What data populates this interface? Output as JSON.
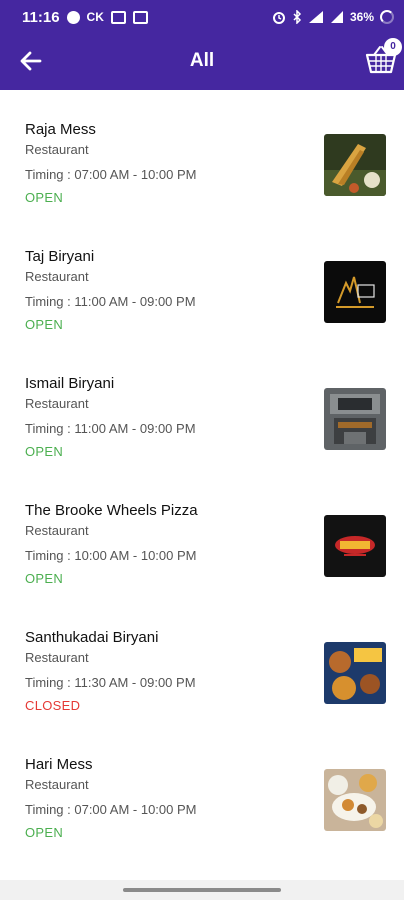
{
  "status_bar": {
    "time": "11:16",
    "network_label": "CK",
    "battery": "36%",
    "icons": [
      "message-icon",
      "ck-icon",
      "media-icon",
      "media-icon",
      "alarm-icon",
      "bluetooth-icon",
      "signal-icon",
      "signal-icon",
      "battery-icon"
    ]
  },
  "app_bar": {
    "title": "All",
    "cart_count": "0",
    "icons": {
      "back": "arrow-left-icon",
      "cart": "basket-icon"
    }
  },
  "colors": {
    "primary": "#4527a0",
    "open": "#4caf50",
    "closed": "#e53935"
  },
  "restaurants": [
    {
      "name": "Raja Mess",
      "category": "Restaurant",
      "timing": "Timing : 07:00 AM - 10:00 PM",
      "status": "OPEN",
      "image": "dosa-image"
    },
    {
      "name": "Taj Biryani",
      "category": "Restaurant",
      "timing": "Timing : 11:00 AM - 09:00 PM",
      "status": "OPEN",
      "image": "taj-biryani-logo-image"
    },
    {
      "name": "Ismail Biryani",
      "category": "Restaurant",
      "timing": "Timing : 11:00 AM - 09:00 PM",
      "status": "OPEN",
      "image": "storefront-image"
    },
    {
      "name": "The Brooke Wheels Pizza",
      "category": "Restaurant",
      "timing": "Timing : 10:00 AM - 10:00 PM",
      "status": "OPEN",
      "image": "pizza-logo-image"
    },
    {
      "name": "Santhukadai Biryani",
      "category": "Restaurant",
      "timing": "Timing : 11:30 AM - 09:00 PM",
      "status": "CLOSED",
      "image": "biryani-poster-image"
    },
    {
      "name": "Hari Mess",
      "category": "Restaurant",
      "timing": "Timing : 07:00 AM - 10:00 PM",
      "status": "OPEN",
      "image": "meals-image"
    }
  ]
}
